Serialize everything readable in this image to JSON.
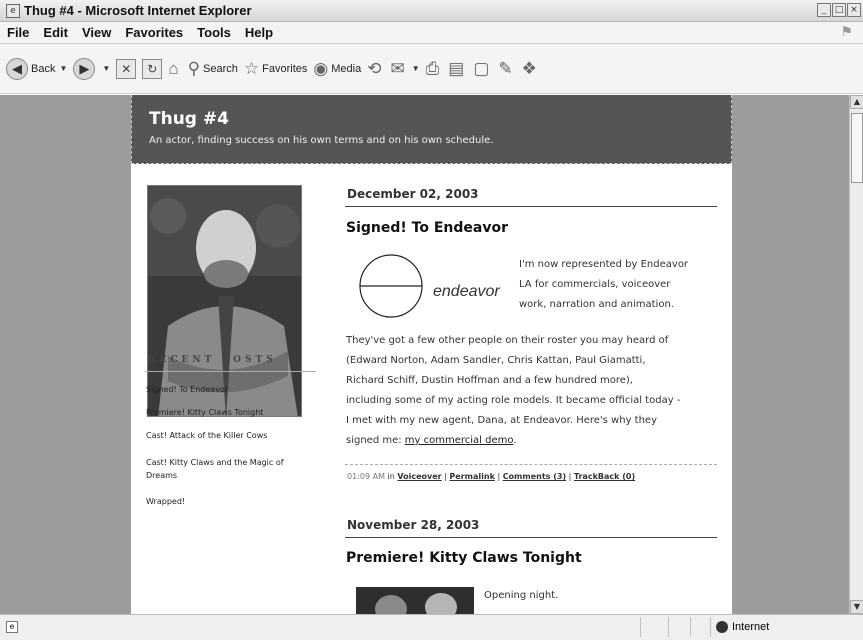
{
  "window": {
    "title": "Thug #4 - Microsoft Internet Explorer"
  },
  "menu": [
    "File",
    "Edit",
    "View",
    "Favorites",
    "Tools",
    "Help"
  ],
  "toolbar": {
    "back_label": "Back",
    "search_label": "Search",
    "favorites_label": "Favorites",
    "media_label": "Media"
  },
  "blog": {
    "title": "Thug #4",
    "tagline": "An actor, finding success on his own terms and on his own schedule."
  },
  "sidebar": {
    "heading": "RECENT POSTS",
    "recent_posts": [
      "Signed! To Endeavor",
      "Premiere! Kitty Claws Tonight",
      "Cast! Attack of the Killer Cows",
      "Cast! Kitty Claws and the Magic of Dreams",
      "Wrapped!"
    ]
  },
  "posts": [
    {
      "date": "December 02, 2003",
      "title": "Signed! To Endeavor",
      "logo_text": "endeavor",
      "intro_lines": [
        "I'm now represented by Endeavor",
        "LA for commercials, voiceover",
        "work, narration and animation."
      ],
      "body_lines": [
        "They've got a few other people on their roster you may heard of",
        "(Edward Norton, Adam Sandler, Chris Kattan, Paul Giamatti,",
        "Richard Schiff, Dustin Hoffman and a few hundred more),",
        "including some of my acting role models. It became official today -",
        "I met with my new agent, Dana, at Endeavor. Here's why they"
      ],
      "last_line_prefix": "signed me: ",
      "link_text": "my commercial demo",
      "last_line_suffix": ".",
      "meta": {
        "time": "01:09 AM",
        "in": "in",
        "category": "Voiceover",
        "permalink": "Permalink",
        "comments": "Comments (3)",
        "trackback": "TrackBack (0)"
      }
    },
    {
      "date": "November 28, 2003",
      "title": "Premiere! Kitty Claws Tonight",
      "intro": "Opening night."
    }
  ],
  "status": {
    "zone": "Internet"
  }
}
